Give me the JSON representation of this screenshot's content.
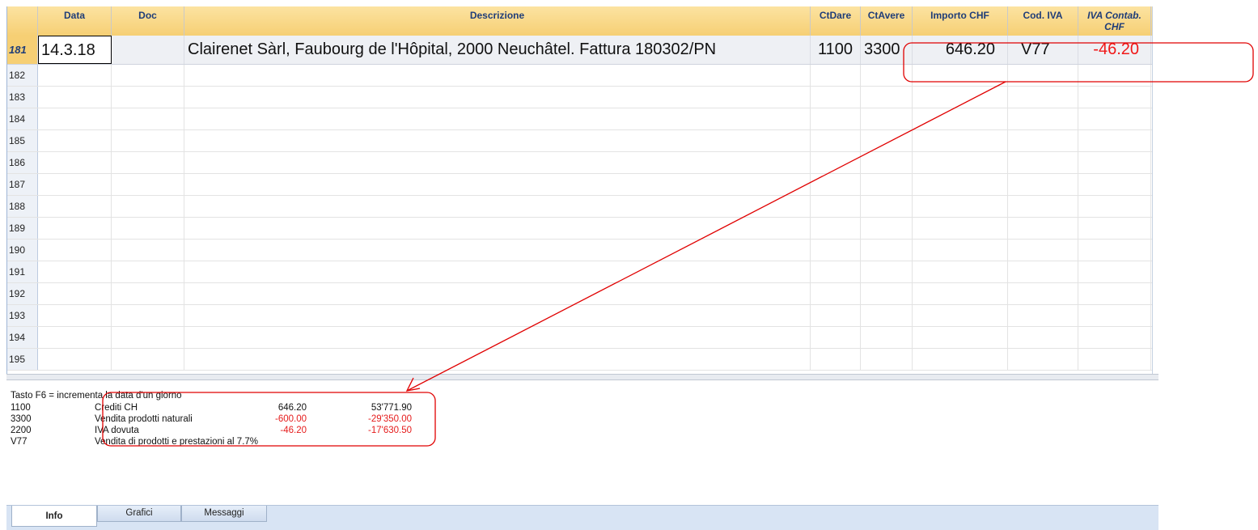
{
  "columns": {
    "data": "Data",
    "doc": "Doc",
    "descrizione": "Descrizione",
    "ctdare": "CtDare",
    "ctavere": "CtAvere",
    "importo": "Importo CHF",
    "codiva": "Cod. IVA",
    "ivacontab_1": "IVA Contab.",
    "ivacontab_2": "CHF"
  },
  "active_row": {
    "num": "181",
    "data": "14.3.18",
    "doc": "",
    "descrizione": "Clairenet Sàrl, Faubourg de l'Hôpital, 2000 Neuchâtel. Fattura 180302/PN",
    "ctdare": "1100",
    "ctavere": "3300",
    "importo": "646.20",
    "codiva": "V77",
    "ivacontab": "-46.20"
  },
  "empty_rows": [
    "182",
    "183",
    "184",
    "185",
    "186",
    "187",
    "188",
    "189",
    "190",
    "191",
    "192",
    "193",
    "194",
    "195"
  ],
  "info": {
    "hint": "Tasto F6 = incrementa la data d'un giorno",
    "lines": [
      {
        "account": "1100",
        "description": "Crediti CH",
        "amount": "646.20",
        "balance": "53'771.90"
      },
      {
        "account": "3300",
        "description": "Vendita prodotti naturali",
        "amount": "-600.00",
        "balance": "-29'350.00"
      },
      {
        "account": "2200",
        "description": "IVA dovuta",
        "amount": "-46.20",
        "balance": "-17'630.50"
      },
      {
        "account": "V77",
        "description": "Vendita di prodotti e prestazioni al 7.7%",
        "amount": "",
        "balance": ""
      }
    ]
  },
  "tabs": [
    {
      "label": "Info",
      "selected": true
    },
    {
      "label": "Grafici",
      "selected": false
    },
    {
      "label": "Messaggi",
      "selected": false
    }
  ],
  "colors": {
    "header_bg": "#f6cf74",
    "header_text": "#1f3d78",
    "negative": "#e51b1b",
    "annotation": "#e00000"
  }
}
